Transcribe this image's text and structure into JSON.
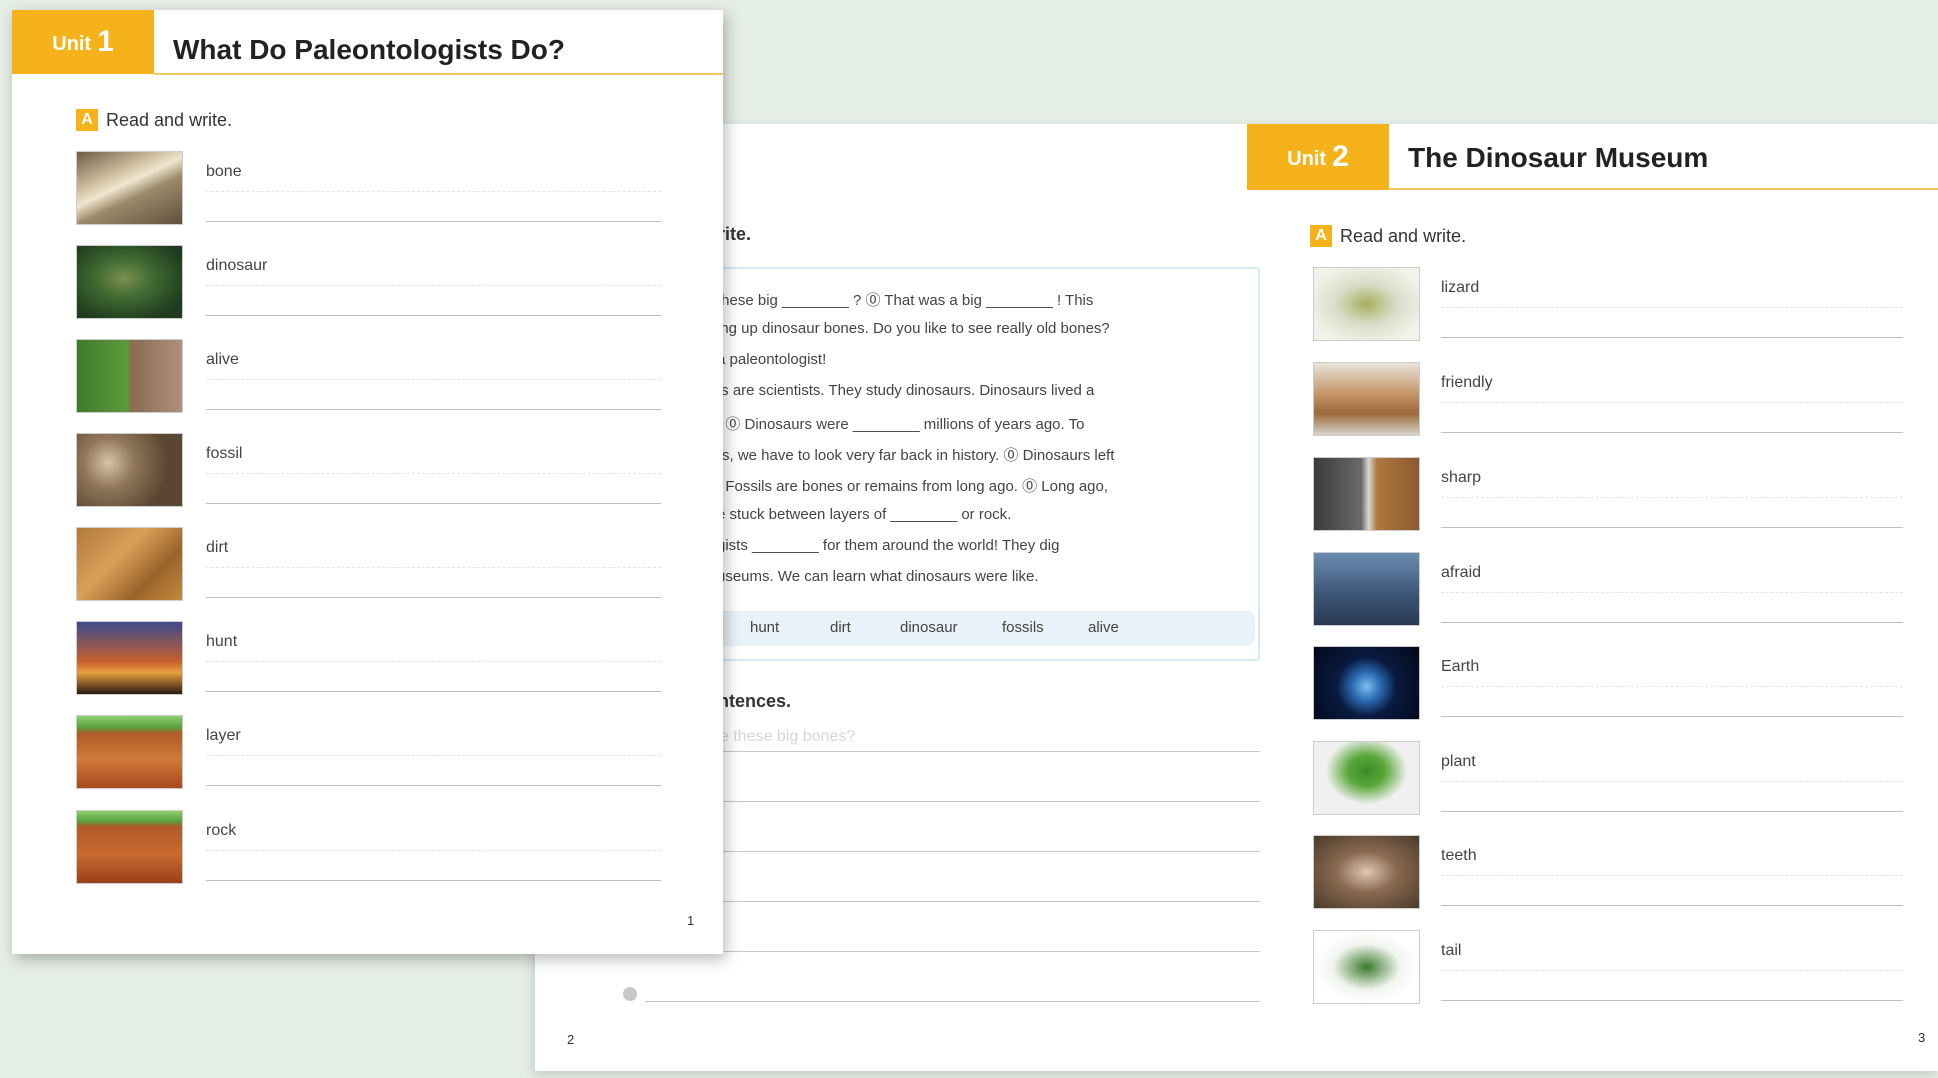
{
  "unit1": {
    "unit_word": "Unit",
    "unit_number": "1",
    "title": "What Do Paleontologists Do?",
    "section_letter": "A",
    "section_instruction": "Read and write.",
    "page_number": "1",
    "vocab": [
      {
        "word": "bone",
        "image": "bone-photo"
      },
      {
        "word": "dinosaur",
        "image": "dinosaur-photo"
      },
      {
        "word": "alive",
        "image": "alive-photo"
      },
      {
        "word": "fossil",
        "image": "fossil-photo"
      },
      {
        "word": "dirt",
        "image": "dirt-photo"
      },
      {
        "word": "hunt",
        "image": "hunt-photo"
      },
      {
        "word": "layer",
        "image": "layer-photo"
      },
      {
        "word": "rock",
        "image": "rock-photo"
      }
    ]
  },
  "page2": {
    "section_b_head": "rite.",
    "reading_lines": [
      "these big ________ ? ⓪ That was a big ________ ! This",
      "ing up dinosaur bones. Do you like to see really old bones?",
      "a paleontologist!",
      "ts are scientists. They study dinosaurs. Dinosaurs lived a",
      ". ⓪ Dinosaurs were ________ millions of years ago. To",
      "rs, we have to look very far back in history. ⓪ Dinosaurs left",
      ". Fossils are bones or remains from long ago. ⓪ Long ago,",
      "e stuck between layers of ________ or rock.",
      "gists ________ for them around the world! They dig",
      "useums. We can learn what dinosaurs were like."
    ],
    "word_bank": [
      "hunt",
      "dirt",
      "dinosaur",
      "fossils",
      "alive"
    ],
    "section_c_head": "ntences.",
    "sentence_example": "e these big bones?",
    "page_number": "2"
  },
  "unit2": {
    "unit_word": "Unit",
    "unit_number": "2",
    "title": "The Dinosaur Museum",
    "section_letter": "A",
    "section_instruction": "Read and write.",
    "page_number": "3",
    "vocab": [
      {
        "word": "lizard",
        "image": "lizard-photo"
      },
      {
        "word": "friendly",
        "image": "friendly-photo"
      },
      {
        "word": "sharp",
        "image": "sharp-photo"
      },
      {
        "word": "afraid",
        "image": "afraid-photo"
      },
      {
        "word": "Earth",
        "image": "earth-photo"
      },
      {
        "word": "plant",
        "image": "plant-photo"
      },
      {
        "word": "teeth",
        "image": "teeth-photo"
      },
      {
        "word": "tail",
        "image": "tail-photo"
      }
    ]
  },
  "colors": {
    "accent": "#f5b21b",
    "background": "#e5eee6",
    "reading_border": "#d6e9f4",
    "word_bank_bg": "#e8f2f8"
  }
}
